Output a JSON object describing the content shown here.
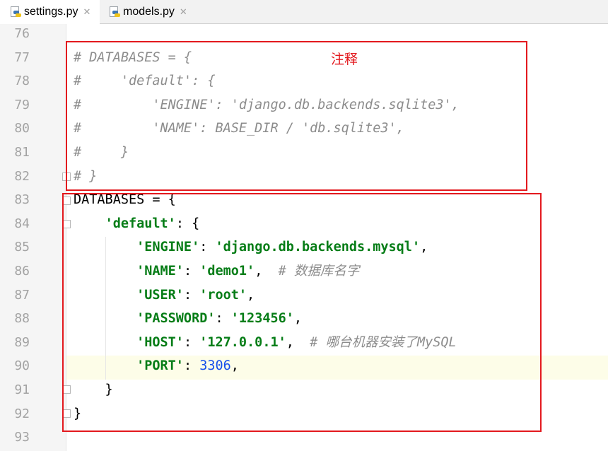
{
  "tabs": [
    {
      "label": "settings.py",
      "active": true,
      "icon": "python-file-icon"
    },
    {
      "label": "models.py",
      "active": false,
      "icon": "python-file-icon"
    }
  ],
  "tab_close_glyph": "✕",
  "current_line": 90,
  "annotation": {
    "text": "注释",
    "color": "#e3191e"
  },
  "colors": {
    "comment": "#8c8c8c",
    "string": "#067d17",
    "number": "#1750eb",
    "highlight_box": "#e3191e"
  },
  "lines": [
    {
      "n": "76",
      "parts": []
    },
    {
      "n": "77",
      "parts": [
        {
          "t": "# DATABASES = {",
          "c": "cm"
        }
      ]
    },
    {
      "n": "78",
      "parts": [
        {
          "t": "#     'default': {",
          "c": "cm"
        }
      ]
    },
    {
      "n": "79",
      "parts": [
        {
          "t": "#         'ENGINE': 'django.db.backends.sqlite3',",
          "c": "cm"
        }
      ]
    },
    {
      "n": "80",
      "parts": [
        {
          "t": "#         'NAME': BASE_DIR / 'db.sqlite3',",
          "c": "cm"
        }
      ]
    },
    {
      "n": "81",
      "parts": [
        {
          "t": "#     }",
          "c": "cm"
        }
      ]
    },
    {
      "n": "82",
      "parts": [
        {
          "t": "# }",
          "c": "cm"
        }
      ]
    },
    {
      "n": "83",
      "parts": [
        {
          "t": "DATABASES = {",
          "c": ""
        }
      ]
    },
    {
      "n": "84",
      "parts": [
        {
          "t": "    ",
          "c": ""
        },
        {
          "t": "'default'",
          "c": "str"
        },
        {
          "t": ": {",
          "c": ""
        }
      ]
    },
    {
      "n": "85",
      "parts": [
        {
          "t": "        ",
          "c": ""
        },
        {
          "t": "'ENGINE'",
          "c": "str"
        },
        {
          "t": ": ",
          "c": ""
        },
        {
          "t": "'django.db.backends.mysql'",
          "c": "str"
        },
        {
          "t": ",",
          "c": ""
        }
      ]
    },
    {
      "n": "86",
      "parts": [
        {
          "t": "        ",
          "c": ""
        },
        {
          "t": "'NAME'",
          "c": "str"
        },
        {
          "t": ": ",
          "c": ""
        },
        {
          "t": "'demo1'",
          "c": "str"
        },
        {
          "t": ",  ",
          "c": ""
        },
        {
          "t": "# 数据库名字",
          "c": "cm"
        }
      ]
    },
    {
      "n": "87",
      "parts": [
        {
          "t": "        ",
          "c": ""
        },
        {
          "t": "'USER'",
          "c": "str"
        },
        {
          "t": ": ",
          "c": ""
        },
        {
          "t": "'root'",
          "c": "str"
        },
        {
          "t": ",",
          "c": ""
        }
      ]
    },
    {
      "n": "88",
      "parts": [
        {
          "t": "        ",
          "c": ""
        },
        {
          "t": "'PASSWORD'",
          "c": "str"
        },
        {
          "t": ": ",
          "c": ""
        },
        {
          "t": "'123456'",
          "c": "str"
        },
        {
          "t": ",",
          "c": ""
        }
      ]
    },
    {
      "n": "89",
      "parts": [
        {
          "t": "        ",
          "c": ""
        },
        {
          "t": "'HOST'",
          "c": "str"
        },
        {
          "t": ": ",
          "c": ""
        },
        {
          "t": "'127.0.0.1'",
          "c": "str"
        },
        {
          "t": ",  ",
          "c": ""
        },
        {
          "t": "# 哪台机器安装了MySQL",
          "c": "cm"
        }
      ]
    },
    {
      "n": "90",
      "parts": [
        {
          "t": "        ",
          "c": ""
        },
        {
          "t": "'PORT'",
          "c": "str"
        },
        {
          "t": ": ",
          "c": ""
        },
        {
          "t": "3306",
          "c": "num"
        },
        {
          "t": ",",
          "c": ""
        }
      ]
    },
    {
      "n": "91",
      "parts": [
        {
          "t": "    }",
          "c": ""
        }
      ]
    },
    {
      "n": "92",
      "parts": [
        {
          "t": "}",
          "c": ""
        }
      ]
    },
    {
      "n": "93",
      "parts": []
    }
  ]
}
